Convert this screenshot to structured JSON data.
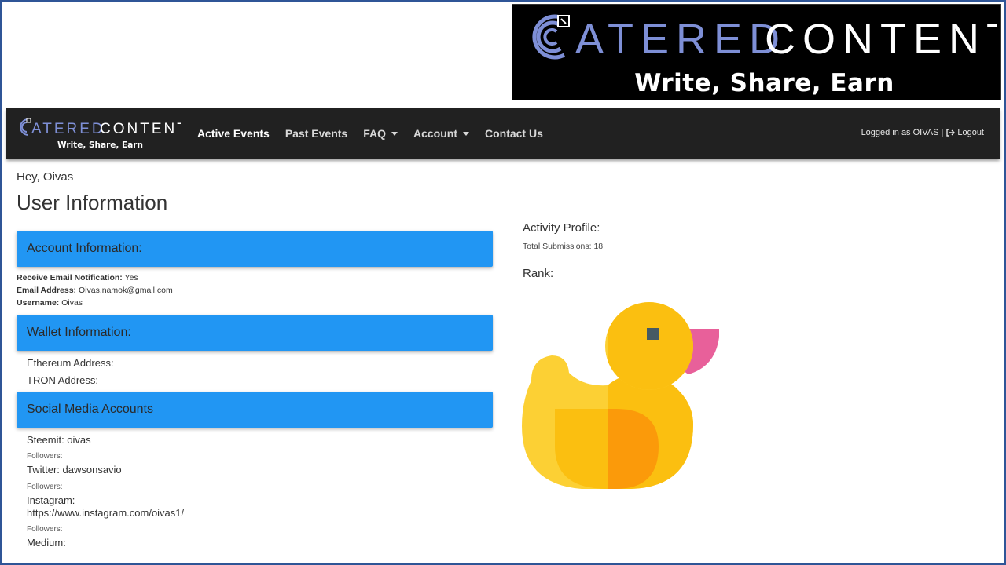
{
  "brand": {
    "name": "CATEREDCONTENT",
    "name_part_1": "ATERED",
    "name_part_2": "CONTENT",
    "tagline": "Write, Share, Earn",
    "colors": {
      "accent_blue": "#7e8fd6",
      "bar_blue": "#2196f3",
      "navbar": "#212121"
    }
  },
  "navbar": {
    "items": [
      {
        "label": "Active Events",
        "active": true
      },
      {
        "label": "Past Events"
      },
      {
        "label": "FAQ",
        "dropdown": true
      },
      {
        "label": "Account",
        "dropdown": true
      },
      {
        "label": "Contact Us"
      }
    ],
    "logged_in_text": "Logged in as OIVAS |",
    "logout_label": "Logout",
    "logout_icon": "sign-out-icon"
  },
  "main": {
    "greeting": "Hey, Oivas",
    "title": "User Information",
    "account_section": {
      "heading": "Account Information:",
      "email_notification_label": "Receive Email Notification:",
      "email_notification_value": "Yes",
      "email_label": "Email Address:",
      "email_value": "Oivas.namok@gmail.com",
      "username_label": "Username:",
      "username_value": "Oivas"
    },
    "wallet_section": {
      "heading": "Wallet Information:",
      "ethereum_label": "Ethereum Address:",
      "tron_label": "TRON Address:"
    },
    "social_section": {
      "heading": "Social Media Accounts",
      "accounts": [
        {
          "label": "Steemit: oivas",
          "followers": "Followers:"
        },
        {
          "label": "Twitter: dawsonsavio",
          "followers": "Followers:"
        },
        {
          "label": "Instagram:",
          "url": "https://www.instagram.com/oivas1/",
          "followers": "Followers:"
        },
        {
          "label": "Medium:"
        }
      ]
    },
    "activity": {
      "title": "Activity Profile:",
      "total_submissions": "Total Submissions: 18",
      "rank_title": "Rank:",
      "rank_icon": "rubber-duck-icon"
    }
  }
}
